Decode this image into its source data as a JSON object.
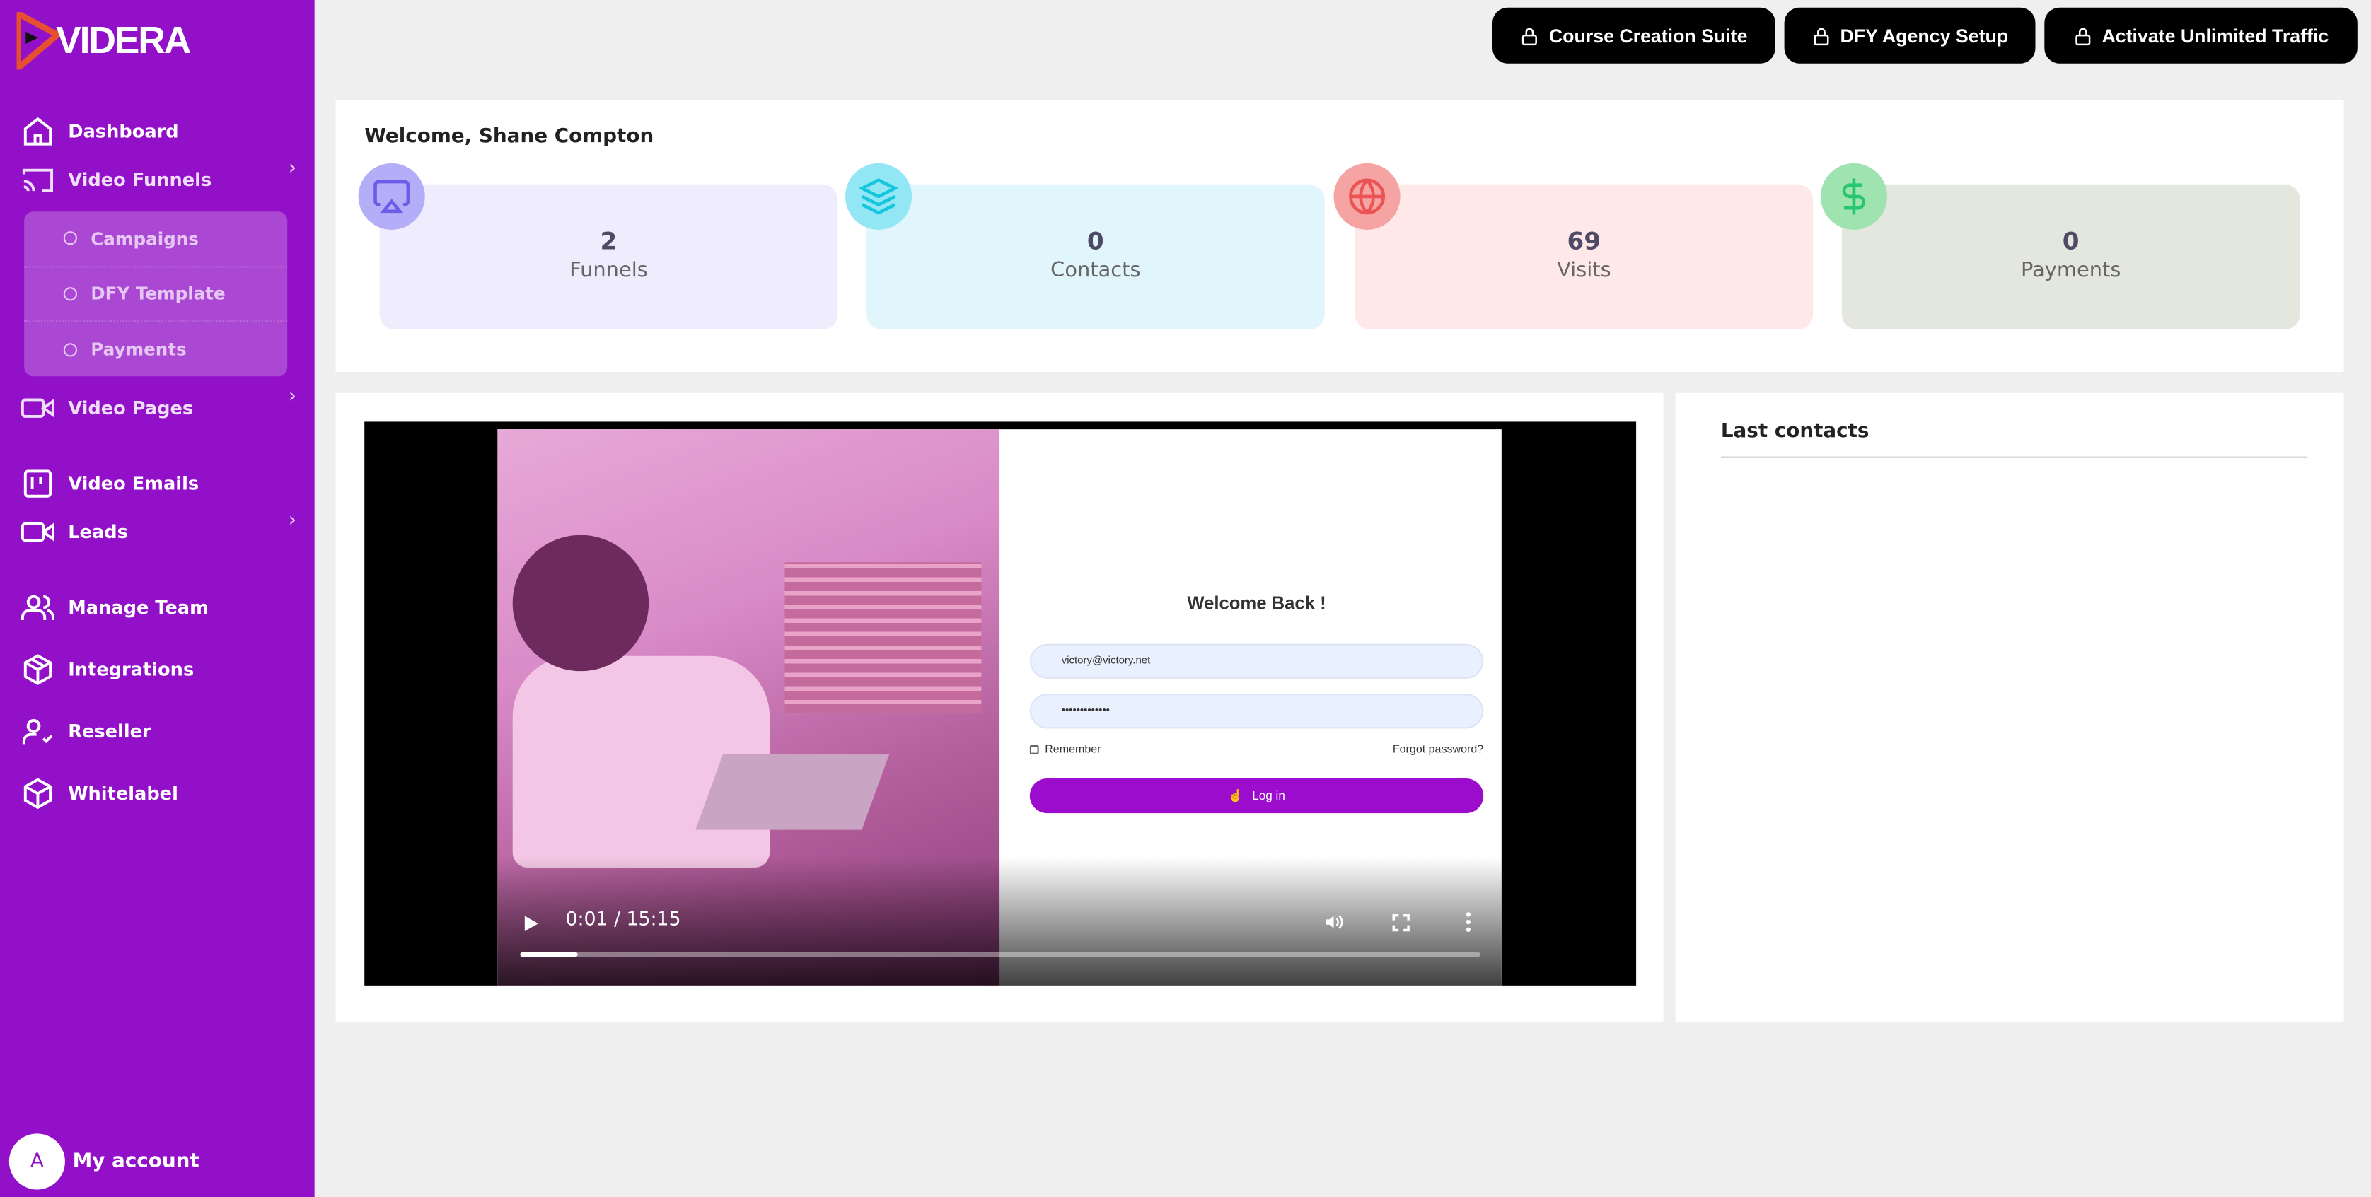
{
  "brand": {
    "name": "VIDERA",
    "accent": "#9210c8"
  },
  "sidebar": {
    "items": [
      {
        "label": "Dashboard",
        "icon": "home-icon"
      },
      {
        "label": "Video Funnels",
        "icon": "cast-icon",
        "expandable": true
      },
      {
        "label": "Video Pages",
        "icon": "video-icon",
        "expandable": true
      },
      {
        "label": "Video Emails",
        "icon": "board-icon"
      },
      {
        "label": "Leads",
        "icon": "video-icon",
        "expandable": true
      },
      {
        "label": "Manage Team",
        "icon": "users-icon"
      },
      {
        "label": "Integrations",
        "icon": "box-icon"
      },
      {
        "label": "Reseller",
        "icon": "user-check-icon"
      },
      {
        "label": "Whitelabel",
        "icon": "cube-icon"
      }
    ],
    "submenu": [
      {
        "label": "Campaigns"
      },
      {
        "label": "DFY Template"
      },
      {
        "label": "Payments"
      }
    ],
    "account": {
      "avatar": "A",
      "label": "My account"
    }
  },
  "topbar": {
    "buttons": [
      {
        "label": "Course Creation Suite",
        "icon": "lock-icon"
      },
      {
        "label": "DFY Agency Setup",
        "icon": "lock-icon"
      },
      {
        "label": "Activate Unlimited Traffic",
        "icon": "lock-icon"
      }
    ]
  },
  "welcome": {
    "title": "Welcome, Shane Compton"
  },
  "stats": [
    {
      "value": "2",
      "label": "Funnels",
      "icon": "airplay-icon",
      "bg": "#eeecfd",
      "circle": "#b3aef7",
      "iconColor": "#6c5ce7"
    },
    {
      "value": "0",
      "label": "Contacts",
      "icon": "layers-icon",
      "bg": "#e1f6fc",
      "circle": "#93e6f3",
      "iconColor": "#14c7dd"
    },
    {
      "value": "69",
      "label": "Visits",
      "icon": "globe-icon",
      "bg": "#ffe8e8",
      "circle": "#f6a3a3",
      "iconColor": "#ea5455"
    },
    {
      "value": "0",
      "label": "Payments",
      "icon": "dollar-icon",
      "bg": "#e4e7dd",
      "circle": "#9ee3b0",
      "iconColor": "#28c76f"
    }
  ],
  "video": {
    "login": {
      "title": "Welcome Back !",
      "email": "victory@victory.net",
      "password": "•••••••••••••",
      "remember": "Remember",
      "forgot": "Forgot password?",
      "button": "Log in"
    },
    "time": "0:01 / 15:15",
    "progress": 0.06
  },
  "last_contacts": {
    "title": "Last contacts"
  }
}
